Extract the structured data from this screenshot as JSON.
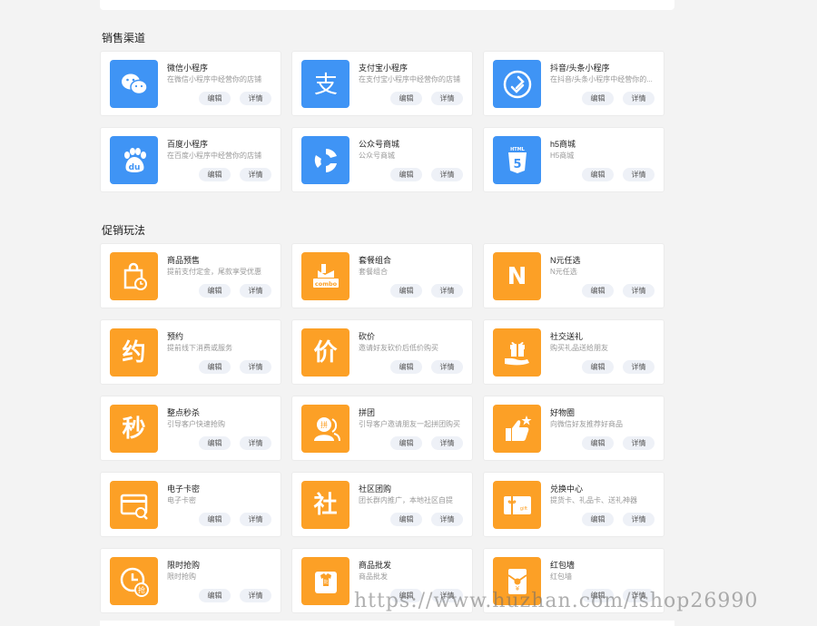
{
  "sections": [
    {
      "title": "销售渠道",
      "cards": [
        {
          "title": "微信小程序",
          "desc": "在微信小程序中经营你的店铺",
          "icon": "wechat-icon",
          "color": "blue",
          "edit": "编辑",
          "detail": "详情"
        },
        {
          "title": "支付宝小程序",
          "desc": "在支付宝小程序中经营你的店铺",
          "icon": "alipay-icon",
          "color": "blue",
          "edit": "编辑",
          "detail": "详情"
        },
        {
          "title": "抖音/头条小程序",
          "desc": "在抖音/头条小程序中经营你的...",
          "icon": "link-icon",
          "color": "blue",
          "edit": "编辑",
          "detail": "详情"
        },
        {
          "title": "百度小程序",
          "desc": "在百度小程序中经营你的店铺",
          "icon": "baidu-icon",
          "color": "blue",
          "edit": "编辑",
          "detail": "详情"
        },
        {
          "title": "公众号商城",
          "desc": "公众号商城",
          "icon": "swirl-icon",
          "color": "blue",
          "edit": "编辑",
          "detail": "详情"
        },
        {
          "title": "h5商城",
          "desc": "H5商城",
          "icon": "html5-icon",
          "color": "blue",
          "edit": "编辑",
          "detail": "详情"
        }
      ]
    },
    {
      "title": "促销玩法",
      "cards": [
        {
          "title": "商品预售",
          "desc": "提前支付定金，尾款享受优惠",
          "icon": "presale-bag-icon",
          "color": "orange",
          "edit": "编辑",
          "detail": "详情"
        },
        {
          "title": "套餐组合",
          "desc": "套餐组合",
          "icon": "combo-icon",
          "color": "orange",
          "edit": "编辑",
          "detail": "详情"
        },
        {
          "title": "N元任选",
          "desc": "N元任选",
          "icon": "n-letter-icon",
          "glyph": "N",
          "color": "orange",
          "edit": "编辑",
          "detail": "详情"
        },
        {
          "title": "预约",
          "desc": "提前线下消费或服务",
          "icon": "appointment-icon",
          "glyph": "约",
          "color": "orange",
          "edit": "编辑",
          "detail": "详情"
        },
        {
          "title": "砍价",
          "desc": "邀请好友砍价后低价购买",
          "icon": "bargain-icon",
          "glyph": "价",
          "color": "orange",
          "edit": "编辑",
          "detail": "详情"
        },
        {
          "title": "社交送礼",
          "desc": "购买礼品送给朋友",
          "icon": "gift-hand-icon",
          "color": "orange",
          "edit": "编辑",
          "detail": "详情"
        },
        {
          "title": "整点秒杀",
          "desc": "引导客户快速抢购",
          "icon": "flash-sale-icon",
          "glyph": "秒",
          "color": "orange",
          "edit": "编辑",
          "detail": "详情"
        },
        {
          "title": "拼团",
          "desc": "引导客户邀请朋友一起拼团购买",
          "icon": "group-buy-icon",
          "color": "orange",
          "edit": "编辑",
          "detail": "详情"
        },
        {
          "title": "好物圈",
          "desc": "向微信好友推荐好商品",
          "icon": "thumbs-up-icon",
          "color": "orange",
          "edit": "编辑",
          "detail": "详情"
        },
        {
          "title": "电子卡密",
          "desc": "电子卡密",
          "icon": "card-key-icon",
          "color": "orange",
          "edit": "编辑",
          "detail": "详情"
        },
        {
          "title": "社区团购",
          "desc": "团长群内推广，本地社区自提",
          "icon": "community-bag-icon",
          "glyph": "社",
          "color": "orange",
          "edit": "编辑",
          "detail": "详情"
        },
        {
          "title": "兑换中心",
          "desc": "提货卡、礼品卡、送礼神器",
          "icon": "gift-card-icon",
          "color": "orange",
          "edit": "编辑",
          "detail": "详情"
        },
        {
          "title": "限时抢购",
          "desc": "限时抢购",
          "icon": "clock-grab-icon",
          "color": "orange",
          "edit": "编辑",
          "detail": "详情"
        },
        {
          "title": "商品批发",
          "desc": "商品批发",
          "icon": "wholesale-icon",
          "color": "orange",
          "edit": "编辑",
          "detail": "详情"
        },
        {
          "title": "红包墙",
          "desc": "红包墙",
          "icon": "red-packet-icon",
          "color": "orange",
          "edit": "编辑",
          "detail": "详情"
        }
      ]
    }
  ],
  "watermark": "https://www.huzhan.com/ishop26990"
}
